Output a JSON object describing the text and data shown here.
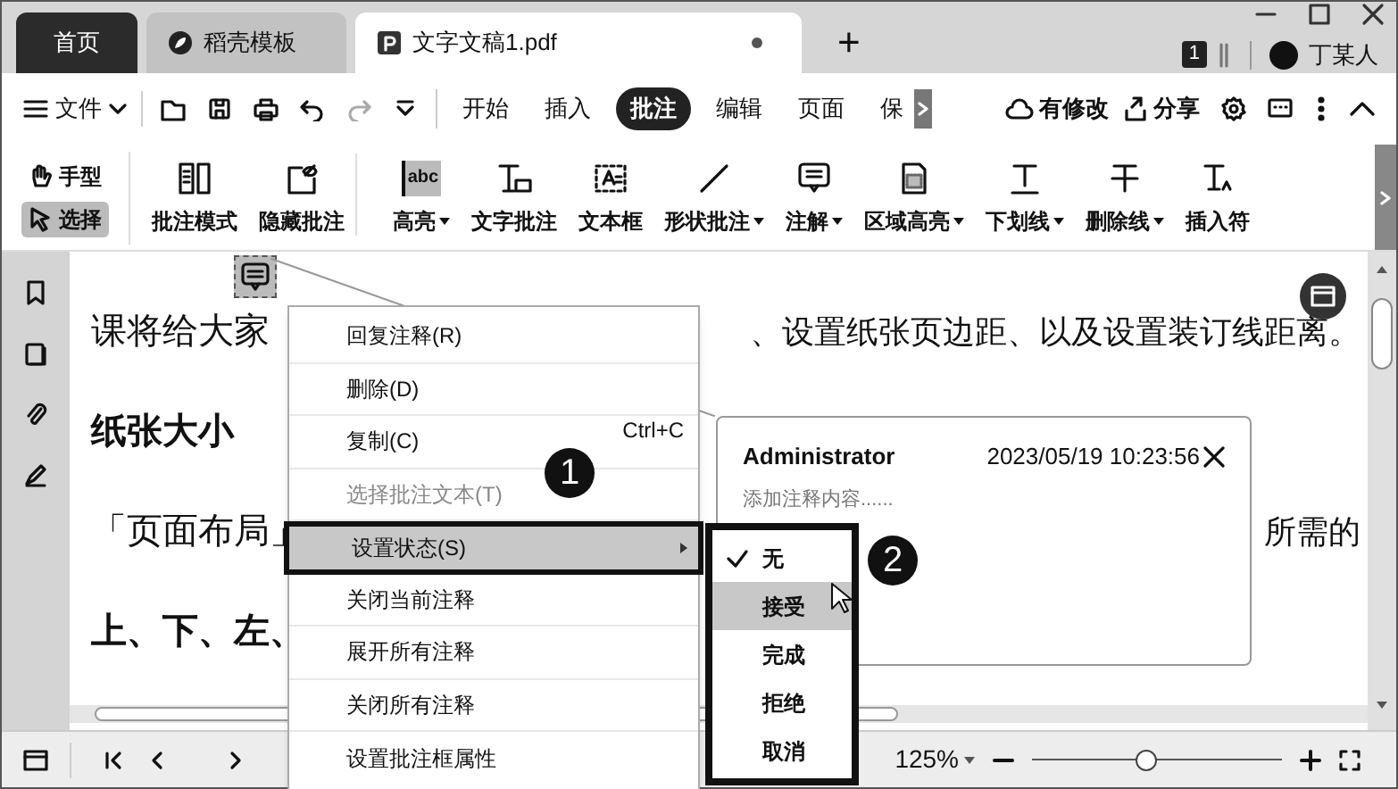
{
  "tabs": [
    {
      "label": "首页",
      "selected": false,
      "kind": "home"
    },
    {
      "label": "稻壳模板",
      "selected": false,
      "kind": "template"
    },
    {
      "label": "文字文稿1.pdf",
      "selected": true,
      "kind": "pdf",
      "modified": true
    }
  ],
  "new_tab": "+",
  "account": {
    "badge": "1",
    "user": "丁某人"
  },
  "menu_bar": {
    "file": "文件",
    "tabs": [
      {
        "label": "开始",
        "selected": false
      },
      {
        "label": "插入",
        "selected": false
      },
      {
        "label": "批注",
        "selected": true
      },
      {
        "label": "编辑",
        "selected": false
      },
      {
        "label": "页面",
        "selected": false
      },
      {
        "label": "保",
        "selected": false
      }
    ],
    "status": "有修改",
    "share": "分享"
  },
  "toolbar": {
    "tools": [
      {
        "label": "手型",
        "selected": false
      },
      {
        "label": "选择",
        "selected": true
      }
    ],
    "items": [
      {
        "label": "批注模式",
        "dropdown": false
      },
      {
        "label": "隐藏批注",
        "dropdown": false
      },
      {
        "label": "高亮",
        "dropdown": true,
        "icon_text": "abc"
      },
      {
        "label": "文字批注",
        "dropdown": false
      },
      {
        "label": "文本框",
        "dropdown": false
      },
      {
        "label": "形状批注",
        "dropdown": true
      },
      {
        "label": "注解",
        "dropdown": true
      },
      {
        "label": "区域高亮",
        "dropdown": true
      },
      {
        "label": "下划线",
        "dropdown": true
      },
      {
        "label": "删除线",
        "dropdown": true
      },
      {
        "label": "插入符",
        "dropdown": false
      }
    ]
  },
  "document": {
    "lines": [
      {
        "left": "课将给大家",
        "right": "、设置纸张页边距、以及设置装订线距离。",
        "bold": false
      },
      {
        "left": "纸张大小",
        "bold": true
      },
      {
        "left": "「页面布局」",
        "right": "所需的",
        "bold": false
      },
      {
        "left": "上、下、左、",
        "bold": true
      }
    ]
  },
  "context_menu": {
    "items": [
      {
        "label": "回复注释(R)",
        "disabled": false,
        "highlighted": false
      },
      {
        "label": "删除(D)",
        "disabled": false,
        "highlighted": false
      },
      {
        "label": "复制(C)",
        "shortcut": "Ctrl+C",
        "disabled": false,
        "highlighted": false
      },
      {
        "label": "选择批注文本(T)",
        "disabled": true,
        "highlighted": false
      },
      {
        "label": "设置状态(S)",
        "disabled": false,
        "highlighted": true,
        "submenu": true
      },
      {
        "label": "关闭当前注释",
        "disabled": false,
        "highlighted": false
      },
      {
        "label": "展开所有注释",
        "disabled": false,
        "highlighted": false
      },
      {
        "label": "关闭所有注释",
        "disabled": false,
        "highlighted": false
      },
      {
        "label": "设置批注框属性",
        "disabled": false,
        "highlighted": false
      }
    ]
  },
  "status_submenu": {
    "items": [
      {
        "label": "无",
        "checked": true,
        "selected": false
      },
      {
        "label": "接受",
        "checked": false,
        "selected": true
      },
      {
        "label": "完成",
        "checked": false,
        "selected": false
      },
      {
        "label": "拒绝",
        "checked": false,
        "selected": false
      },
      {
        "label": "取消",
        "checked": false,
        "selected": false
      }
    ]
  },
  "comment": {
    "author": "Administrator",
    "time": "2023/05/19 10:23:56",
    "placeholder": "添加注释内容......"
  },
  "callouts": [
    "1",
    "2"
  ],
  "status_bar": {
    "zoom": "125%",
    "level": 0.46
  }
}
